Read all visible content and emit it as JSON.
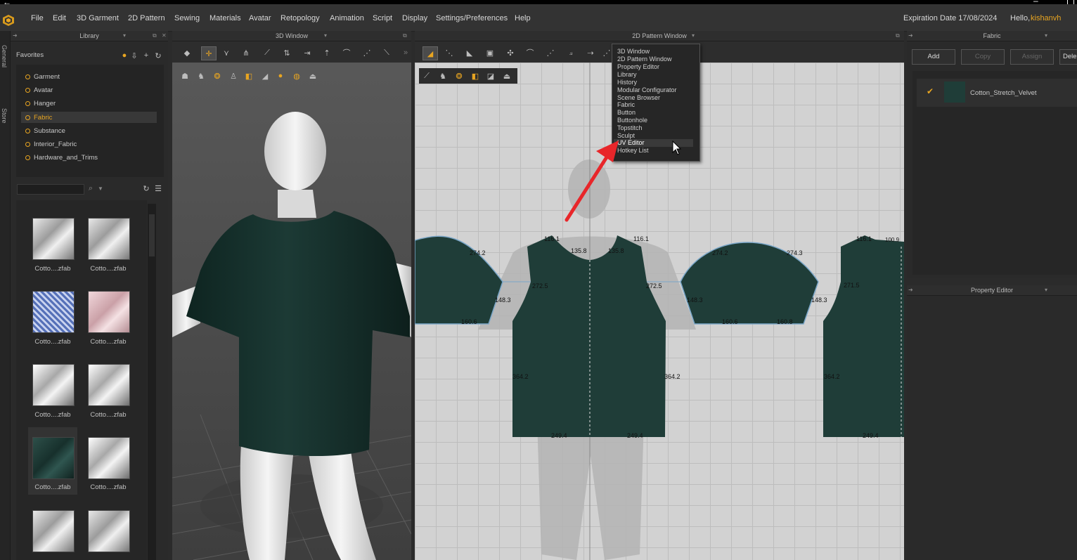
{
  "menu": {
    "items": [
      "File",
      "Edit",
      "3D Garment",
      "2D Pattern",
      "Sewing",
      "Materials",
      "Avatar",
      "Retopology",
      "Animation",
      "Script",
      "Display",
      "Settings/Preferences",
      "Help"
    ],
    "expiration": "Expiration Date 17/08/2024",
    "hello": "Hello,",
    "username": "kishanvh"
  },
  "side_tabs": [
    "General",
    "Store"
  ],
  "library": {
    "title": "Library",
    "favorites_label": "Favorites",
    "items": [
      "Garment",
      "Avatar",
      "Hanger",
      "Fabric",
      "Substance",
      "Interior_Fabric",
      "Hardware_and_Trims"
    ],
    "selected": "Fabric",
    "thumbnails": [
      "Cotto....zfab",
      "Cotto....zfab",
      "Cotto....zfab",
      "Cotto....zfab",
      "Cotto....zfab",
      "Cotto....zfab",
      "Cotto....zfab",
      "Cotto....zfab"
    ]
  },
  "window3d": {
    "title": "3D Window"
  },
  "window2d": {
    "title": "2D Pattern Window"
  },
  "fabric_panel": {
    "title": "Fabric",
    "buttons": [
      "Add",
      "Copy",
      "Assign",
      "Dele"
    ],
    "fabric_name": "Cotton_Stretch_Velvet",
    "swatch_color": "#1f3d38"
  },
  "property_editor": {
    "title": "Property Editor"
  },
  "dropdown": {
    "items": [
      "3D Window",
      "2D Pattern Window",
      "Property Editor",
      "Library",
      "History",
      "Modular Configurator",
      "Scene Browser",
      "Fabric",
      "Button",
      "Buttonhole",
      "Topstitch",
      "Sculpt",
      "UV Editor",
      "Hotkey List"
    ],
    "highlighted": "UV Editor"
  },
  "measurements": {
    "sleeve_left_top": "274.2",
    "sleeve_left_side": "148.3",
    "sleeve_left_bottom": "160.6",
    "front_shoulder_l": "116.1",
    "front_neck_l": "135.8",
    "front_neck_r": "135.8",
    "front_shoulder_r": "116.1",
    "front_armhole_l": "272.5",
    "front_armhole_r": "272.5",
    "front_side_l": "364.2",
    "front_side_r": "364.2",
    "front_hem_l": "249.4",
    "front_hem_r": "249.4",
    "sleeve2_top_l": "274.2",
    "sleeve2_top_r": "274.3",
    "sleeve2_side_l": "148.3",
    "sleeve2_side_r": "148.3",
    "sleeve2_bottom_l": "160.6",
    "sleeve2_bottom_r": "160.8",
    "back_shoulder": "116.1",
    "back_neck": "100.9",
    "back_armhole": "271.5",
    "back_side": "364.2",
    "back_hem": "249.4"
  },
  "colors": {
    "accent": "#e8a521",
    "garment": "#1f3d38",
    "arrow": "#e8262a"
  }
}
